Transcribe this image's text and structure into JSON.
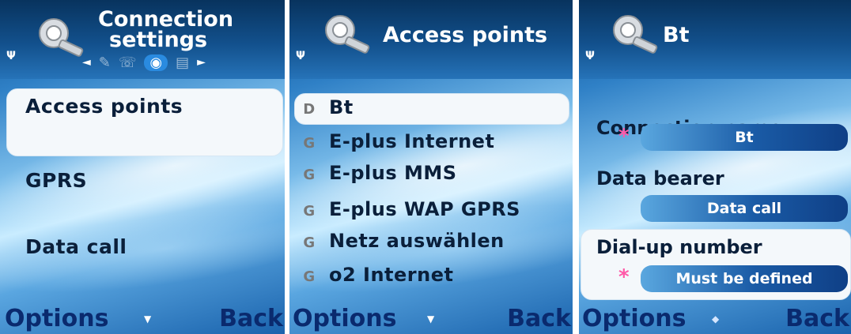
{
  "screen1": {
    "title_line1": "Connection",
    "title_line2": "settings",
    "tabs": [
      "◄",
      "✎",
      "☏",
      "◉",
      "▤",
      "►"
    ],
    "items": [
      "Access points",
      "GPRS",
      "Data call"
    ],
    "softkeys": {
      "left": "Options",
      "right": "Back"
    }
  },
  "screen2": {
    "title": "Access points",
    "items": [
      {
        "icon": "D",
        "label": "Bt"
      },
      {
        "icon": "G",
        "label": "E-plus Internet"
      },
      {
        "icon": "G",
        "label": "E-plus MMS"
      },
      {
        "icon": "G",
        "label": "E-plus WAP GPRS"
      },
      {
        "icon": "G",
        "label": "Netz auswählen"
      },
      {
        "icon": "G",
        "label": "o2 Internet"
      }
    ],
    "softkeys": {
      "left": "Options",
      "right": "Back"
    }
  },
  "screen3": {
    "title": "Bt",
    "fields": [
      {
        "label": "Connection name",
        "value": "Bt",
        "required": "*"
      },
      {
        "label": "Data bearer",
        "value": "Data call",
        "required": ""
      },
      {
        "label": "Dial-up number",
        "value": "Must be defined",
        "required": "*"
      }
    ],
    "softkeys": {
      "left": "Options",
      "right": "Back"
    }
  },
  "icons": {
    "signal": "Ψ",
    "down_arrow": "▼",
    "updown_arrow": "◆"
  },
  "colors": {
    "header": "#12508c",
    "softkey": "#0a2a6e",
    "required": "#ff5aa8"
  }
}
